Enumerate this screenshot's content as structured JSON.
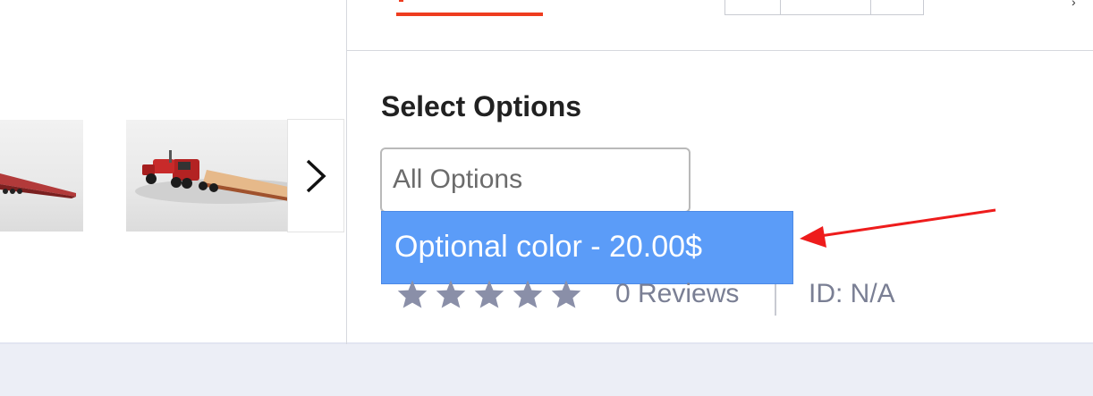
{
  "product": {
    "options_heading": "Select Options",
    "select": {
      "current_value": "All Options",
      "options": [
        {
          "label": "Optional color - 20.00$",
          "highlighted": true
        }
      ]
    },
    "rating": {
      "stars": 5,
      "filled": 0,
      "reviews_label": "0 Reviews"
    },
    "id_label": "ID: N/A"
  },
  "gallery": {
    "thumbnails": [
      {
        "name": "flatbed-trailer-side-view"
      },
      {
        "name": "red-truck-with-flatbed-trailer"
      }
    ],
    "next_icon": "chevron-right-icon"
  },
  "annotation": {
    "icon": "red-arrow-pointer",
    "color": "#ee1c1c"
  },
  "colors": {
    "accent": "#ee3c1f",
    "dropdown_highlight": "#5b9cf8",
    "star": "#8a8fa8",
    "muted_text": "#7a7f94"
  }
}
